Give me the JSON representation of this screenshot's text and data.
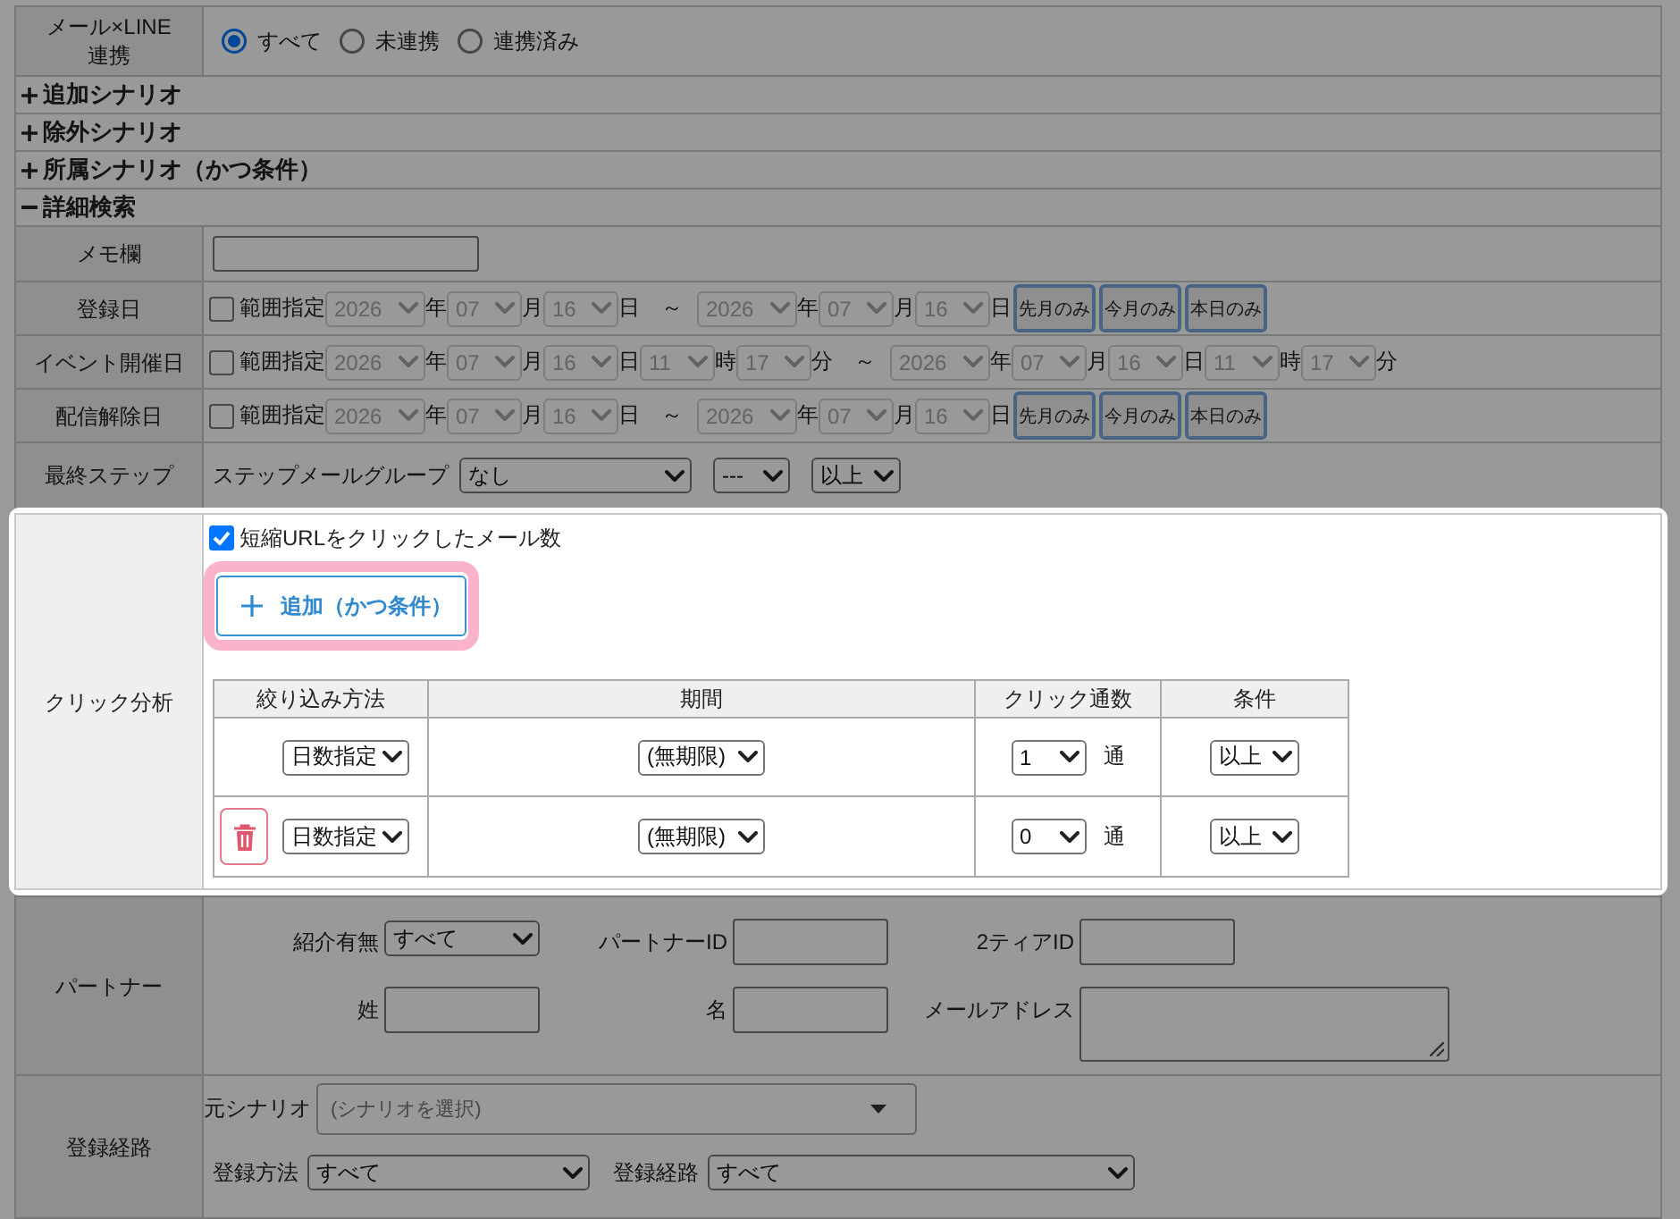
{
  "form": {
    "sections": [
      {
        "kind": "radio",
        "label": "メール×LINE\n連携",
        "highlighted": false,
        "options": [
          {
            "label": "すべて",
            "selected": true
          },
          {
            "label": "未連携",
            "selected": false
          },
          {
            "label": "連携済み",
            "selected": false
          }
        ]
      },
      {
        "kind": "toggle",
        "label": "追加シナリオ",
        "expanded": false,
        "highlighted": false
      },
      {
        "kind": "toggle",
        "label": "除外シナリオ",
        "expanded": false,
        "highlighted": false
      },
      {
        "kind": "toggle",
        "label": "所属シナリオ（かつ条件）",
        "expanded": false,
        "highlighted": false
      },
      {
        "kind": "toggle",
        "label": "詳細検索",
        "expanded": true,
        "highlighted": false,
        "rows": [
          {
            "kind": "memo",
            "label": "メモ欄",
            "highlighted": false
          },
          {
            "kind": "date_range",
            "label": "登録日",
            "highlighted": false,
            "range": {
              "label": "範囲指定",
              "checked": false
            },
            "from": [
              {
                "value": "2026",
                "unit": "年"
              },
              {
                "value": "07",
                "unit": "月"
              },
              {
                "value": "16",
                "unit": "日"
              }
            ],
            "separator": "～",
            "to": [
              {
                "value": "2026",
                "unit": "年"
              },
              {
                "value": "07",
                "unit": "月"
              },
              {
                "value": "16",
                "unit": "日"
              }
            ],
            "buttons": [
              "先月のみ",
              "今月のみ",
              "本日のみ"
            ]
          },
          {
            "kind": "date_range",
            "label": "イベント開催日",
            "highlighted": false,
            "range": {
              "label": "範囲指定",
              "checked": false
            },
            "from": [
              {
                "value": "2026",
                "unit": "年"
              },
              {
                "value": "07",
                "unit": "月"
              },
              {
                "value": "16",
                "unit": "日"
              },
              {
                "value": "11",
                "unit": "時"
              },
              {
                "value": "17",
                "unit": "分"
              }
            ],
            "separator": "～",
            "to": [
              {
                "value": "2026",
                "unit": "年"
              },
              {
                "value": "07",
                "unit": "月"
              },
              {
                "value": "16",
                "unit": "日"
              },
              {
                "value": "11",
                "unit": "時"
              },
              {
                "value": "17",
                "unit": "分"
              }
            ]
          },
          {
            "kind": "date_range",
            "label": "配信解除日",
            "highlighted": false,
            "range": {
              "label": "範囲指定",
              "checked": false
            },
            "from": [
              {
                "value": "2026",
                "unit": "年"
              },
              {
                "value": "07",
                "unit": "月"
              },
              {
                "value": "16",
                "unit": "日"
              }
            ],
            "separator": "～",
            "to": [
              {
                "value": "2026",
                "unit": "年"
              },
              {
                "value": "07",
                "unit": "月"
              },
              {
                "value": "16",
                "unit": "日"
              }
            ],
            "buttons": [
              "先月のみ",
              "今月のみ",
              "本日のみ"
            ]
          },
          {
            "kind": "step",
            "label": "最終ステップ",
            "highlighted": false,
            "field_label": "ステップメールグループ",
            "selects": [
              "なし",
              "---",
              "以上"
            ]
          },
          {
            "kind": "click",
            "label": "クリック分析",
            "highlighted": true,
            "option": {
              "label": "短縮URLをクリックしたメール数",
              "checked": true
            },
            "add_button": {
              "label": "追加（かつ条件）",
              "highlighted": true
            },
            "table": {
              "columns": [
                "絞り込み方法",
                "期間",
                "クリック通数",
                "条件"
              ],
              "rows": [
                {
                  "deletable": false,
                  "method": "日数指定",
                  "period": "(無期限)",
                  "count": "1",
                  "unit": "通",
                  "condition": "以上"
                },
                {
                  "deletable": true,
                  "method": "日数指定",
                  "period": "(無期限)",
                  "count": "0",
                  "unit": "通",
                  "condition": "以上"
                }
              ]
            }
          },
          {
            "kind": "partner",
            "label": "パートナー",
            "highlighted": false,
            "fields": [
              {
                "kind": "select",
                "label": "紹介有無",
                "value": "すべて"
              },
              {
                "kind": "input",
                "label": "パートナーID"
              },
              {
                "kind": "input",
                "label": "2ティアID"
              },
              {
                "kind": "input",
                "label": "姓"
              },
              {
                "kind": "input",
                "label": "名"
              },
              {
                "kind": "textarea",
                "label": "メールアドレス"
              }
            ]
          },
          {
            "kind": "route",
            "label": "登録経路",
            "highlighted": false,
            "scenario": {
              "label": "元シナリオ",
              "placeholder": "(シナリオを選択)"
            },
            "selects": [
              {
                "label": "登録方法",
                "value": "すべて"
              },
              {
                "label": "登録経路",
                "value": "すべて"
              }
            ]
          }
        ]
      }
    ]
  }
}
